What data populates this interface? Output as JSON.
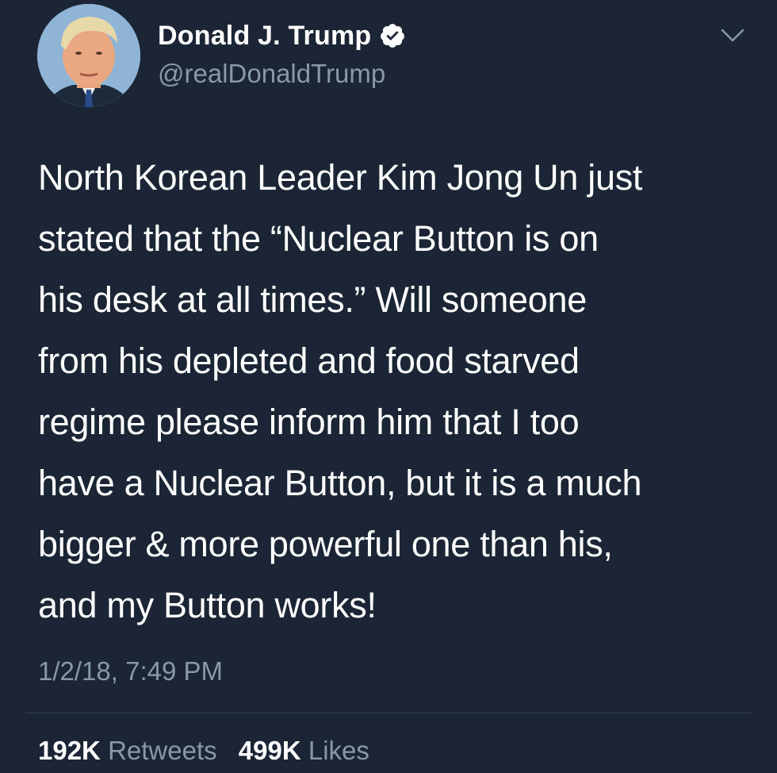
{
  "user": {
    "display_name": "Donald J. Trump",
    "handle": "@realDonaldTrump",
    "verified": true
  },
  "tweet": {
    "lines": [
      "North Korean Leader Kim Jong Un just",
      "stated that the “Nuclear Button is on",
      "his desk at all times.” Will someone",
      "from his depleted and food starved",
      "regime please inform him that I too",
      "have a Nuclear Button, but it is a much",
      "bigger & more powerful one than his,",
      "and my Button works!"
    ],
    "timestamp": "1/2/18, 7:49 PM"
  },
  "stats": {
    "retweets_count": "192K",
    "retweets_label": "Retweets",
    "likes_count": "499K",
    "likes_label": "Likes"
  },
  "icons": {
    "verified": "verified-badge-icon",
    "menu": "chevron-down-icon"
  },
  "colors": {
    "background": "#1b2535",
    "text_primary": "#ffffff",
    "text_secondary": "#8899a6",
    "divider": "#38444d"
  }
}
